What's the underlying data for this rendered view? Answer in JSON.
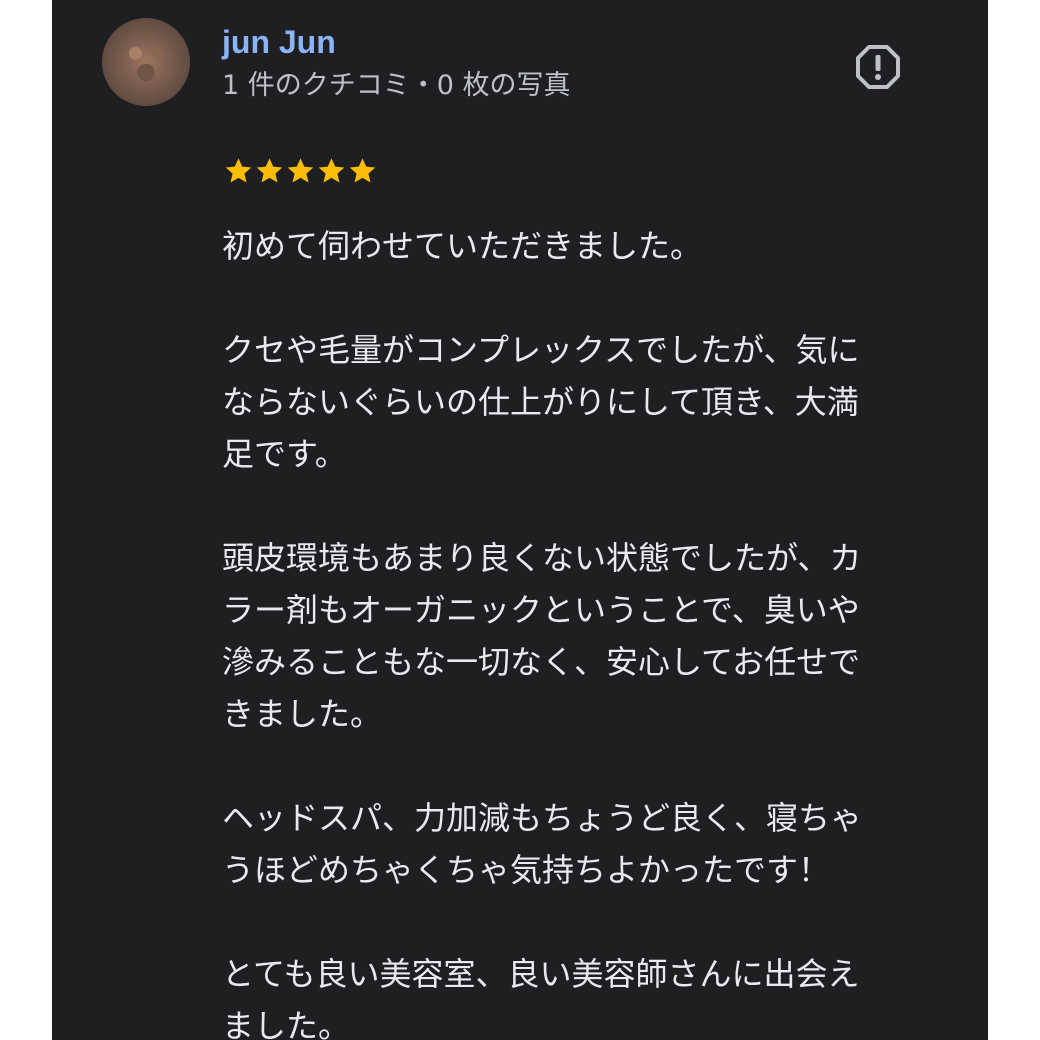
{
  "review": {
    "author": {
      "name": "jun Jun",
      "meta": "1 件のクチコミ・0 枚の写真",
      "avatar_icon": "user-avatar-photo"
    },
    "report_icon": "report-octagon-icon",
    "rating": {
      "value": 5,
      "max": 5,
      "star_color": "#fbbc04",
      "star_icon": "star-icon"
    },
    "paragraphs": [
      [
        "初めて伺わせていただきました。"
      ],
      [
        "クセや毛量がコンプレックスでしたが、気に",
        "ならないぐらいの仕上がりにして頂き、大満",
        "足です。"
      ],
      [
        "頭皮環境もあまり良くない状態でしたが、カ",
        "ラー剤もオーガニックということで、臭いや",
        "滲みることもな一切なく、安心してお任せで",
        "きました。"
      ],
      [
        "ヘッドスパ、力加減もちょうど良く、寝ちゃ",
        "うほどめちゃくちゃ気持ちよかったです！"
      ],
      [
        "とても良い美容室、良い美容師さんに出会え",
        "ました。"
      ]
    ]
  },
  "colors": {
    "background": "#1f1f21",
    "author_name": "#8ab4f8",
    "meta_text": "#bdc1c6",
    "body_text": "#e8eaed",
    "icon": "#bdc1c6"
  }
}
